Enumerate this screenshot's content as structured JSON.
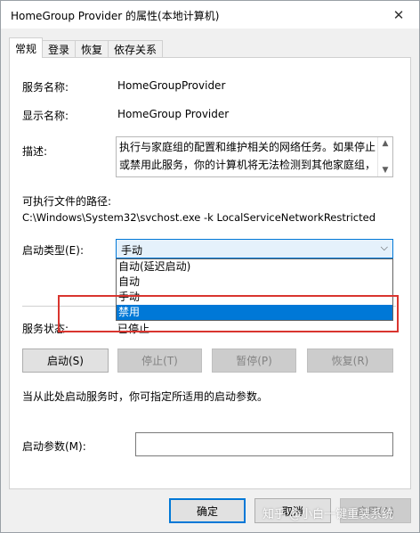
{
  "window": {
    "title": "HomeGroup Provider 的属性(本地计算机)",
    "close_glyph": "✕"
  },
  "tabs": [
    {
      "label": "常规",
      "active": true
    },
    {
      "label": "登录",
      "active": false
    },
    {
      "label": "恢复",
      "active": false
    },
    {
      "label": "依存关系",
      "active": false
    }
  ],
  "general": {
    "service_name_label": "服务名称:",
    "service_name_value": "HomeGroupProvider",
    "display_name_label": "显示名称:",
    "display_name_value": "HomeGroup Provider",
    "description_label": "描述:",
    "description_lines": [
      "执行与家庭组的配置和维护相关的网络任务。如果停止",
      "或禁用此服务，你的计算机将无法检测到其他家庭组，"
    ],
    "exe_path_label": "可执行文件的路径:",
    "exe_path_value": "C:\\Windows\\System32\\svchost.exe -k LocalServiceNetworkRestricted",
    "startup_type_label": "启动类型(E):",
    "startup_type_value": "手动",
    "startup_options": [
      {
        "label": "自动(延迟启动)",
        "selected": false
      },
      {
        "label": "自动",
        "selected": false
      },
      {
        "label": "手动",
        "selected": false
      },
      {
        "label": "禁用",
        "selected": true
      }
    ],
    "service_status_label": "服务状态:",
    "service_status_value": "已停止",
    "buttons": {
      "start": "启动(S)",
      "stop": "停止(T)",
      "pause": "暂停(P)",
      "resume": "恢复(R)"
    },
    "hint_text": "当从此处启动服务时，你可指定所适用的启动参数。",
    "start_params_label": "启动参数(M):",
    "start_params_value": ""
  },
  "footer": {
    "ok": "确定",
    "cancel": "取消",
    "apply": "应用(A)"
  },
  "watermark": "知乎 @小白一键重装系统",
  "colors": {
    "accent": "#0078d7",
    "highlight_box": "#d9352f"
  },
  "icons": {
    "close": "close-icon",
    "desc_up": "scroll-up-icon",
    "desc_down": "scroll-down-icon",
    "select_chevron": "chevron-down-icon"
  }
}
